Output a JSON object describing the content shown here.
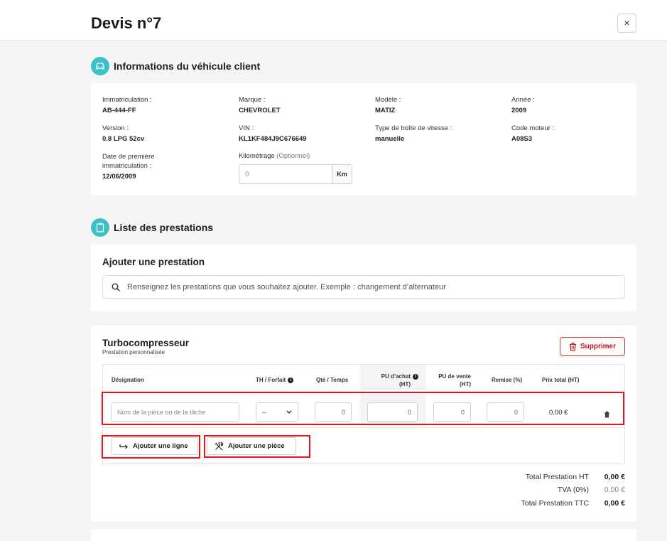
{
  "header": {
    "title": "Devis n°7",
    "close_label": "×"
  },
  "vehicle_section": {
    "title": "Informations du véhicule client",
    "icon": "car-icon",
    "fields": [
      {
        "label": "Immatriculation :",
        "value": "AB-444-FF"
      },
      {
        "label": "Marque :",
        "value": "CHEVROLET"
      },
      {
        "label": "Modèle :",
        "value": "MATIZ"
      },
      {
        "label": "Année :",
        "value": "2009"
      },
      {
        "label": "Version :",
        "value": "0.8 LPG 52cv"
      },
      {
        "label": "VIN :",
        "value": "KL1KF484J9C676649"
      },
      {
        "label": "Type de boîte de vitesse :",
        "value": "manuelle"
      },
      {
        "label": "Code moteur :",
        "value": "A08S3"
      },
      {
        "label": "Date de première immatriculation :",
        "value": "12/06/2009"
      }
    ],
    "mileage": {
      "label": "Kilométrage",
      "optional": "(Optionnel)",
      "placeholder": "0",
      "unit": "Km"
    }
  },
  "services_section": {
    "title": "Liste des prestations",
    "icon": "clipboard-icon",
    "add": {
      "title": "Ajouter une prestation",
      "search_placeholder": "Renseignez les prestations que vous souhaitez ajouter. Exemple : changement d’alternateur"
    }
  },
  "service": {
    "title": "Turbocompresseur",
    "subtitle": "Prestation personnalisée",
    "delete_label": "Supprimer",
    "columns": {
      "designation": "Désignation",
      "th": "TH / Forfait",
      "qty": "Qté / Temps",
      "pu_achat_1": "PU d’achat",
      "pu_achat_2": "(HT)",
      "pu_vente_1": "PU de vente",
      "pu_vente_2": "(HT)",
      "remise": "Remise (%)",
      "total": "Prix total (HT)"
    },
    "row": {
      "designation_placeholder": "Nom de la pièce ou de la tâche",
      "th_value": "--",
      "qty": "0",
      "pu_achat": "0",
      "pu_vente": "0",
      "remise": "0",
      "total": "0,00 €"
    },
    "add_line_label": "Ajouter une ligne",
    "add_part_label": "Ajouter une pièce",
    "totals": [
      {
        "label": "Total Prestation HT",
        "value": "0,00 €"
      },
      {
        "label": "TVA (0%)",
        "value": "0,00 €"
      },
      {
        "label": "Total Prestation TTC",
        "value": "0,00 €"
      }
    ]
  },
  "colors": {
    "accent": "#3cc2c6",
    "danger": "#c0151c",
    "highlight": "#e8141b"
  }
}
